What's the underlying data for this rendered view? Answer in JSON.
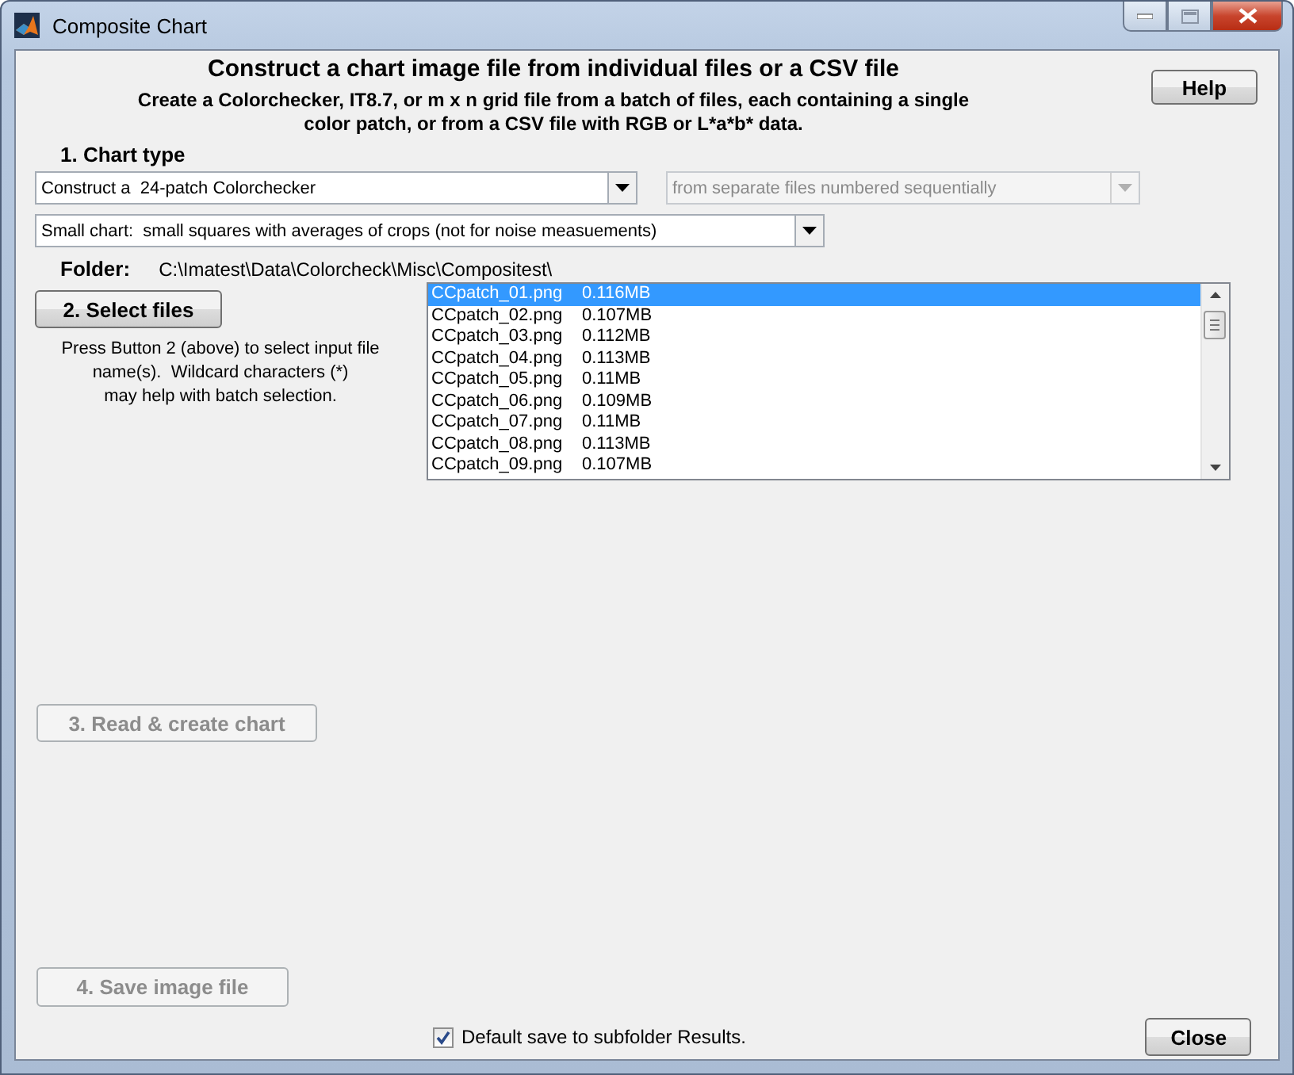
{
  "window": {
    "title": "Composite Chart"
  },
  "heading": "Construct a chart image file from individual files or a CSV file",
  "subtitle": "Create a Colorchecker, IT8.7, or m x n grid file from a batch of files, each containing a single\ncolor patch, or from a CSV file with RGB or L*a*b* data.",
  "help_button": {
    "label": "Help",
    "disabled": false
  },
  "chart_type": {
    "label": "1. Chart type",
    "chart_select": {
      "value": "Construct a  24-patch Colorchecker",
      "disabled": false
    },
    "numbering_select": {
      "value": "from separate files numbered sequentially",
      "disabled": true
    },
    "size_select": {
      "value": "Small chart:  small squares with averages of crops (not for noise measuements)",
      "disabled": false
    }
  },
  "folder": {
    "label": "Folder:",
    "path": "C:\\Imatest\\Data\\Colorcheck\\Misc\\Compositest\\"
  },
  "select_button": {
    "label": "2. Select files",
    "disabled": false
  },
  "select_hint": "Press Button 2 (above) to select input file\nname(s).  Wildcard characters (*)\nmay help with batch selection.",
  "files": [
    {
      "name": "CCpatch_01.png",
      "size": "0.116MB",
      "selected": true
    },
    {
      "name": "CCpatch_02.png",
      "size": "0.107MB",
      "selected": false
    },
    {
      "name": "CCpatch_03.png",
      "size": "0.112MB",
      "selected": false
    },
    {
      "name": "CCpatch_04.png",
      "size": "0.113MB",
      "selected": false
    },
    {
      "name": "CCpatch_05.png",
      "size": "0.11MB",
      "selected": false
    },
    {
      "name": "CCpatch_06.png",
      "size": "0.109MB",
      "selected": false
    },
    {
      "name": "CCpatch_07.png",
      "size": "0.11MB",
      "selected": false
    },
    {
      "name": "CCpatch_08.png",
      "size": "0.113MB",
      "selected": false
    },
    {
      "name": "CCpatch_09.png",
      "size": "0.107MB",
      "selected": false
    }
  ],
  "read_button": {
    "label": "3. Read & create chart",
    "disabled": true
  },
  "save_button": {
    "label": "4. Save image file",
    "disabled": true
  },
  "default_save": {
    "label": "Default save to subfolder Results.",
    "checked": true
  },
  "close_button": {
    "label": "Close",
    "disabled": false
  }
}
